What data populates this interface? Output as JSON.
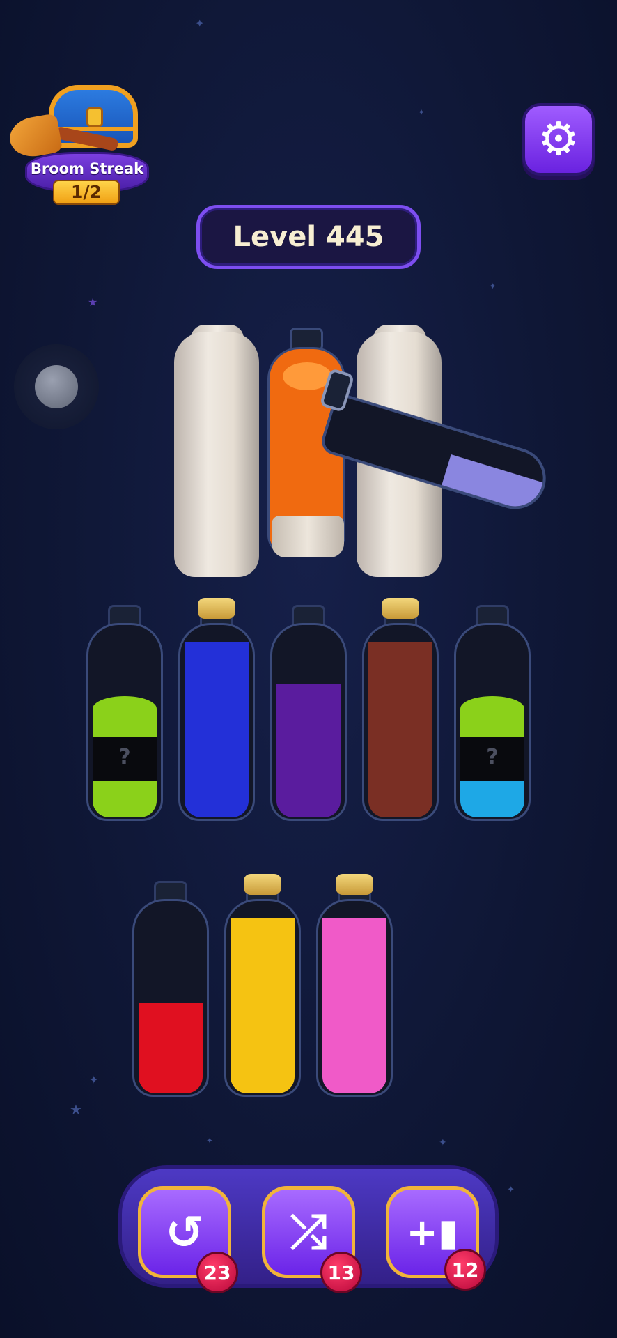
{
  "header": {
    "broom_streak_label": "Broom Streak",
    "broom_streak_count": "1/2",
    "level_label": "Level 445",
    "settings_icon": "gear-icon"
  },
  "colors": {
    "green": "#8bd11a",
    "blue": "#2330d8",
    "purple": "#5a1c9e",
    "brown": "#7a2f24",
    "cyan": "#1ea8e6",
    "red": "#e01020",
    "yellow": "#f5c312",
    "pink": "#f05ac8",
    "orange": "#f06a10",
    "lavender": "#8a86e0"
  },
  "bottles": [
    {
      "id": 1,
      "capped": false,
      "layers_bottom_to_top": [
        "green",
        "hidden",
        "green"
      ],
      "hidden_symbol": "?"
    },
    {
      "id": 2,
      "capped": true,
      "layers_bottom_to_top": [
        "blue",
        "blue",
        "blue",
        "blue"
      ]
    },
    {
      "id": 3,
      "capped": false,
      "layers_bottom_to_top": [
        "purple",
        "purple",
        "purple"
      ]
    },
    {
      "id": 4,
      "capped": true,
      "layers_bottom_to_top": [
        "brown",
        "brown",
        "brown",
        "brown"
      ]
    },
    {
      "id": 5,
      "capped": false,
      "layers_bottom_to_top": [
        "cyan",
        "hidden",
        "green"
      ],
      "hidden_symbol": "?"
    },
    {
      "id": 6,
      "capped": false,
      "layers_bottom_to_top": [
        "red",
        "red"
      ]
    },
    {
      "id": 7,
      "capped": true,
      "layers_bottom_to_top": [
        "yellow",
        "yellow",
        "yellow",
        "yellow"
      ]
    },
    {
      "id": 8,
      "capped": true,
      "layers_bottom_to_top": [
        "pink",
        "pink",
        "pink",
        "pink"
      ]
    }
  ],
  "tools": [
    {
      "name": "undo",
      "icon": "undo-icon",
      "glyph": "↺",
      "count": "23"
    },
    {
      "name": "shuffle",
      "icon": "shuffle-icon",
      "glyph": "⤮",
      "count": "13"
    },
    {
      "name": "add-bottle",
      "icon": "add-bottle-icon",
      "glyph": "+▮",
      "count": "12"
    }
  ]
}
